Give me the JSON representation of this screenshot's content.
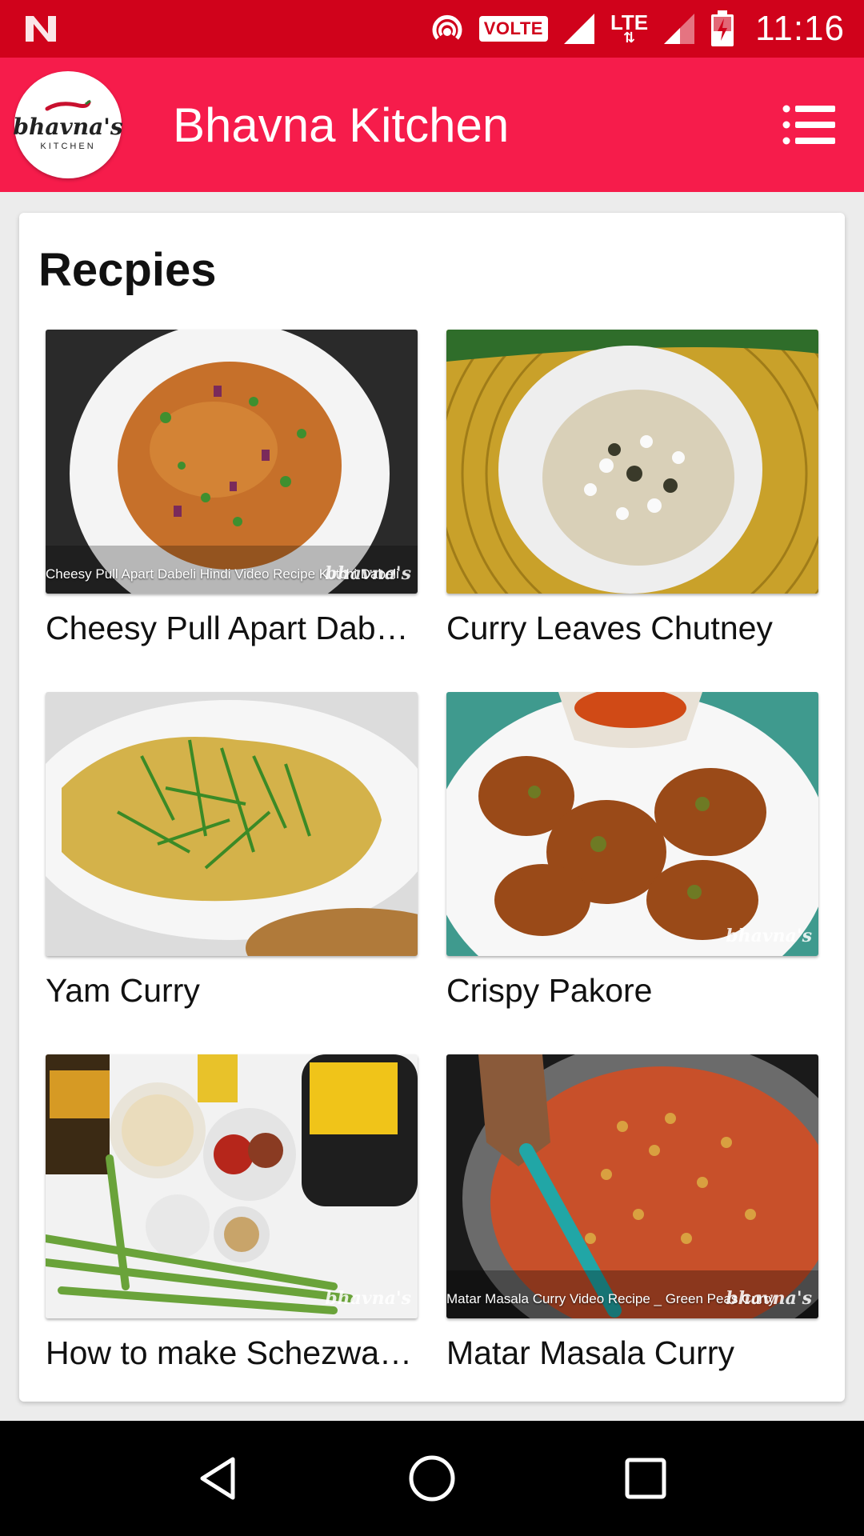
{
  "status_bar": {
    "volte": "VOLTE",
    "lte": "LTE",
    "time": "11:16"
  },
  "app_bar": {
    "title": "Bhavna Kitchen",
    "logo_text": "bhavna's",
    "logo_sub": "KITCHEN",
    "accent_color": "#f61c4b",
    "status_color": "#d0021b"
  },
  "section": {
    "title": "Recpies"
  },
  "recipes": [
    {
      "title": "Cheesy Pull Apart Dabe…",
      "caption": "Cheesy Pull Apart Dabeli Hindi Video Recipe Kutchi Dabeli",
      "watermark": "bhavna's"
    },
    {
      "title": "Curry Leaves Chutney",
      "caption": "",
      "watermark": ""
    },
    {
      "title": "Yam Curry",
      "caption": "",
      "watermark": ""
    },
    {
      "title": "Crispy Pakore",
      "caption": "",
      "watermark": "bhavna's"
    },
    {
      "title": "How to make Schezwa…",
      "caption": "",
      "watermark": "bhavna's"
    },
    {
      "title": "Matar Masala Curry",
      "caption": "Matar Masala Curry Video Recipe _ Green Peas Curry",
      "watermark": "bhavna's"
    }
  ]
}
